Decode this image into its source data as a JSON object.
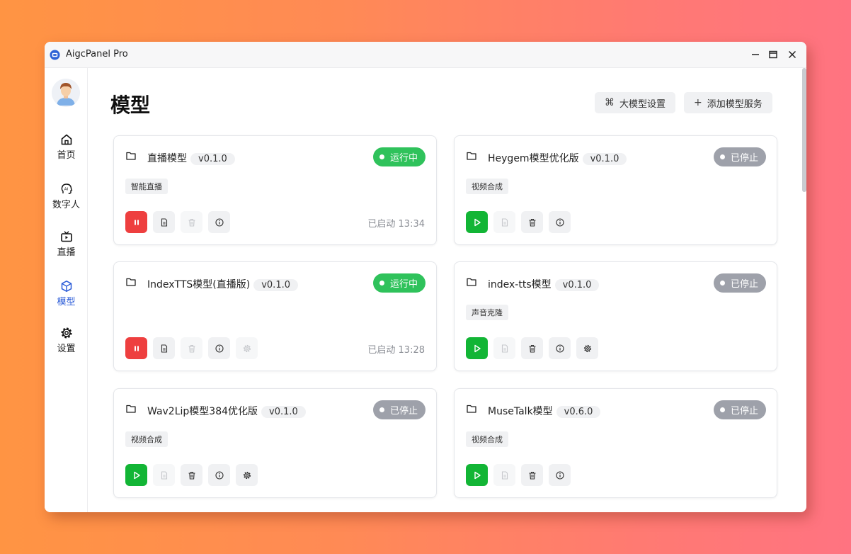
{
  "window": {
    "title": "AigcPanel Pro"
  },
  "sidebar": {
    "items": [
      {
        "label": "首页",
        "icon": "home-icon"
      },
      {
        "label": "数字人",
        "icon": "ai-head-icon"
      },
      {
        "label": "直播",
        "icon": "tv-icon"
      },
      {
        "label": "模型",
        "icon": "cube-icon",
        "active": true
      },
      {
        "label": "设置",
        "icon": "gear-icon"
      }
    ]
  },
  "main": {
    "title": "模型",
    "buttons": {
      "llm_settings": "大模型设置",
      "add_service": "添加模型服务"
    }
  },
  "colors": {
    "running": "#2fc25b",
    "stopped": "#9ea1aa",
    "pause": "#ee3f3f",
    "play": "#12b535",
    "accent": "#2a5bd7"
  },
  "models": [
    {
      "name": "直播模型",
      "version": "v0.1.0",
      "status": "运行中",
      "tag": "智能直播",
      "started": "已启动 13:34"
    },
    {
      "name": "Heygem模型优化版",
      "version": "v0.1.0",
      "status": "已停止",
      "tag": "视频合成",
      "started": ""
    },
    {
      "name": "IndexTTS模型(直播版)",
      "version": "v0.1.0",
      "status": "运行中",
      "tag": "",
      "started": "已启动 13:28"
    },
    {
      "name": "index-tts模型",
      "version": "v0.1.0",
      "status": "已停止",
      "tag": "声音克隆",
      "started": ""
    },
    {
      "name": "Wav2Lip模型384优化版",
      "version": "v0.1.0",
      "status": "已停止",
      "tag": "视频合成",
      "started": ""
    },
    {
      "name": "MuseTalk模型",
      "version": "v0.6.0",
      "status": "已停止",
      "tag": "视频合成",
      "started": ""
    }
  ]
}
